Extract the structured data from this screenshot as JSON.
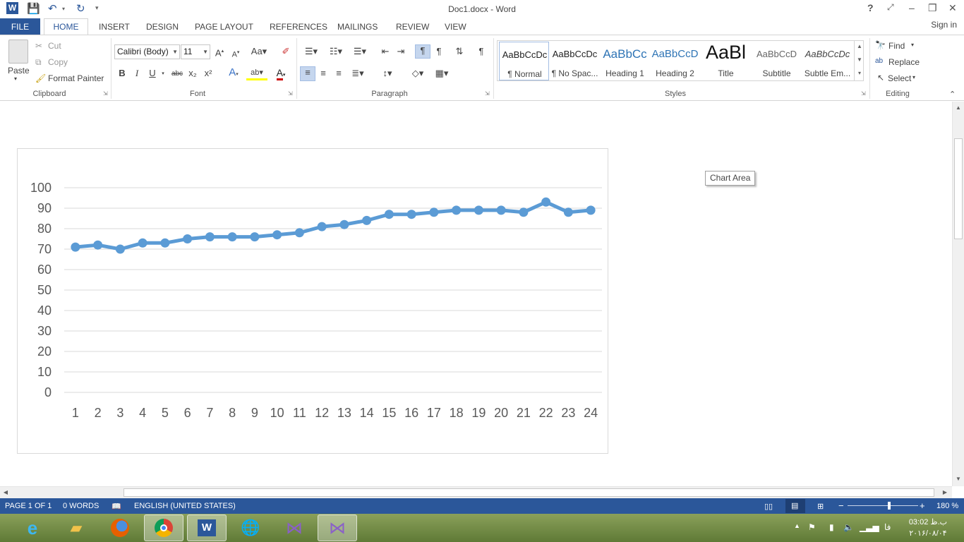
{
  "window": {
    "title": "Doc1.docx - Word",
    "help": "?",
    "minimize": "–",
    "restore": "❐",
    "close": "✕"
  },
  "tabs": {
    "file": "FILE",
    "home": "HOME",
    "insert": "INSERT",
    "design": "DESIGN",
    "page_layout": "PAGE LAYOUT",
    "references": "REFERENCES",
    "mailings": "MAILINGS",
    "review": "REVIEW",
    "view": "VIEW",
    "signin": "Sign in"
  },
  "clipboard": {
    "paste": "Paste",
    "cut": "Cut",
    "copy": "Copy",
    "format_painter": "Format Painter",
    "label": "Clipboard"
  },
  "font": {
    "name": "Calibri (Body)",
    "size": "11",
    "bold": "B",
    "italic": "I",
    "underline": "U",
    "strike": "abc",
    "sub": "x₂",
    "sup": "x²",
    "label": "Font"
  },
  "paragraph": {
    "label": "Paragraph"
  },
  "styles": {
    "label": "Styles",
    "items": [
      {
        "preview": "AaBbCcDc",
        "name": "¶ Normal"
      },
      {
        "preview": "AaBbCcDc",
        "name": "¶ No Spac..."
      },
      {
        "preview": "AaBbCc",
        "name": "Heading 1"
      },
      {
        "preview": "AaBbCcD",
        "name": "Heading 2"
      },
      {
        "preview": "AaBl",
        "name": "Title"
      },
      {
        "preview": "AaBbCcD",
        "name": "Subtitle"
      },
      {
        "preview": "AaBbCcDc",
        "name": "Subtle Em..."
      }
    ]
  },
  "editing": {
    "find": "Find",
    "replace": "Replace",
    "select": "Select",
    "label": "Editing"
  },
  "chart_tooltip": "Chart Area",
  "chart_data": {
    "type": "line",
    "title": "",
    "xlabel": "",
    "ylabel": "",
    "x": [
      1,
      2,
      3,
      4,
      5,
      6,
      7,
      8,
      9,
      10,
      11,
      12,
      13,
      14,
      15,
      16,
      17,
      18,
      19,
      20,
      21,
      22,
      23,
      24
    ],
    "series": [
      {
        "values": [
          71,
          72,
          70,
          73,
          73,
          75,
          76,
          76,
          76,
          77,
          78,
          81,
          82,
          84,
          87,
          87,
          88,
          89,
          89,
          89,
          88,
          93,
          88,
          89
        ],
        "color": "#5b9bd5"
      }
    ],
    "ylim": [
      0,
      100
    ],
    "yticks": [
      0,
      10,
      20,
      30,
      40,
      50,
      60,
      70,
      80,
      90,
      100
    ],
    "grid": true,
    "legend": "none"
  },
  "status": {
    "page": "PAGE 1 OF 1",
    "words": "0 WORDS",
    "language": "ENGLISH (UNITED STATES)",
    "zoom": "180 %",
    "zoom_minus": "−",
    "zoom_plus": "+"
  },
  "taskbar": {
    "apps": [
      "internet-explorer",
      "file-explorer",
      "firefox",
      "chrome",
      "word",
      "internet-download-manager",
      "visual-studio",
      "visual-studio"
    ],
    "clock_time": "03:02 ب.ظ",
    "clock_date": "۲۰۱۶/۰۸/۰۴",
    "lang": "فا"
  }
}
